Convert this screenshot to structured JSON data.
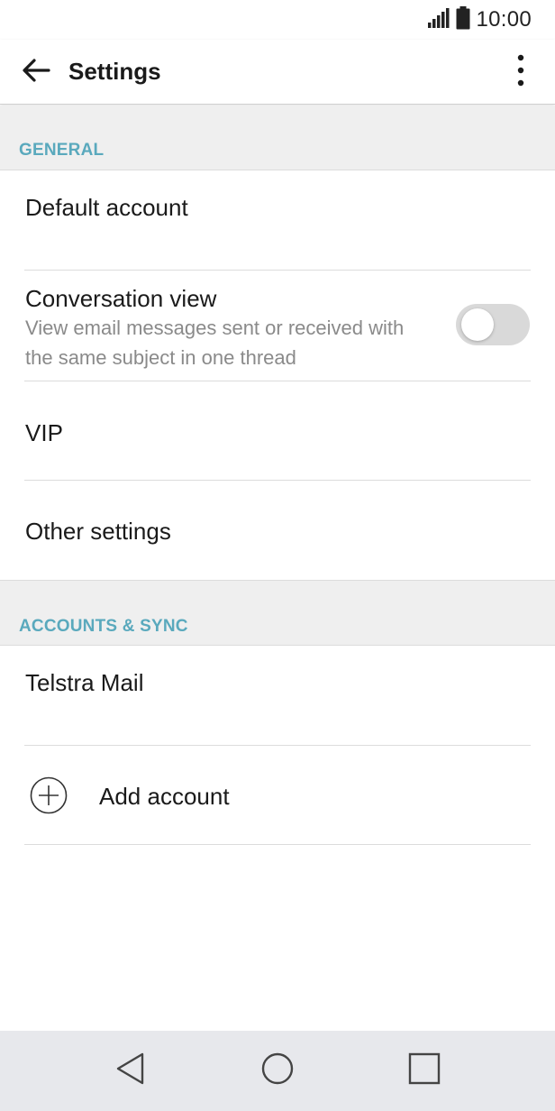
{
  "status_bar": {
    "time": "10:00",
    "signal_icon": "signal-bars-icon",
    "battery_icon": "battery-icon"
  },
  "app_bar": {
    "title": "Settings",
    "back_icon": "arrow-left-icon",
    "more_icon": "more-vert-icon"
  },
  "sections": {
    "general": {
      "label": "GENERAL",
      "items": [
        {
          "title": "Default account"
        },
        {
          "title": "Conversation view",
          "subtitle": "View email messages sent or received with the same subject in one thread",
          "toggle_on": false
        },
        {
          "title": "VIP"
        },
        {
          "title": "Other settings"
        }
      ]
    },
    "accounts": {
      "label": "ACCOUNTS & SYNC",
      "items": [
        {
          "title": "Telstra Mail"
        },
        {
          "title": "Add account",
          "icon": "plus-circle-icon"
        }
      ]
    }
  },
  "nav_bar": {
    "back_icon": "triangle-back-icon",
    "home_icon": "circle-home-icon",
    "recents_icon": "square-recents-icon"
  },
  "colors": {
    "accent": "#5aa9bd",
    "section_bg": "#efefef",
    "nav_bg": "#e7e8ec",
    "toggle_off": "#d9d9d9"
  }
}
